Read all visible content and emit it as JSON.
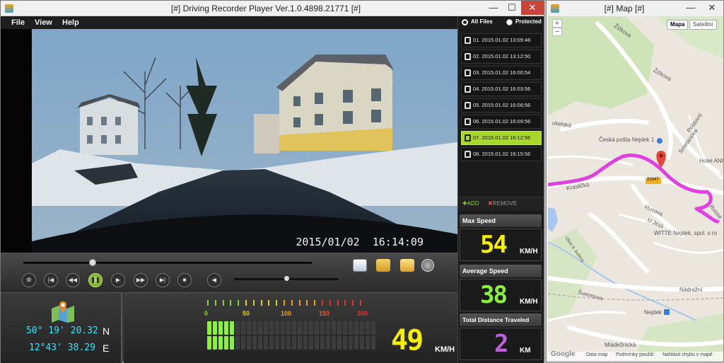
{
  "player": {
    "title": "[#] Driving Recorder Player Ver.1.0.4898.21771 [#]",
    "menu": [
      "File",
      "View",
      "Help"
    ],
    "video": {
      "timestamp": "2015/01/02  16:14:09"
    },
    "seek": {
      "position": 0.24
    },
    "volume": {
      "level": 0.5
    },
    "controls": [
      "settings",
      "prev-file",
      "rewind",
      "pause",
      "play",
      "fast-forward",
      "next-file",
      "stop",
      "volume"
    ],
    "gps": {
      "lat": "50° 19' 20.32",
      "lat_dir": "N",
      "lon": "12°43' 38.29",
      "lon_dir": "E"
    },
    "speedometer": {
      "scale": [
        {
          "label": "0",
          "color": "#8ad23a"
        },
        {
          "label": "50",
          "color": "#e0d020"
        },
        {
          "label": "100",
          "color": "#f0a020"
        },
        {
          "label": "150",
          "color": "#e06030"
        },
        {
          "label": "200",
          "color": "#e03030"
        }
      ],
      "lit_segments": 5,
      "total_segments": 30,
      "current_speed": "49",
      "unit": "KM/H"
    },
    "files": {
      "filter_all": "All Files",
      "filter_protected": "Protected",
      "items": [
        "01. 2015.01.02 13:09:48",
        "02. 2015.01.02 13:12:50",
        "03. 2015.01.02 16:00:54",
        "04. 2015.01.02 16:03:56",
        "05. 2015.01.02 16:06:56",
        "06. 2015.01.02 16:09:56",
        "07. 2015.01.02 16:12:56",
        "08. 2015.01.02 16:15:56"
      ],
      "selected_index": 6,
      "add_label": "ADD",
      "remove_label": "REMOVE"
    },
    "stats": {
      "max_speed_title": "Max Speed",
      "max_speed_value": "54",
      "max_speed_unit": "KM/H",
      "avg_speed_title": "Average Speed",
      "avg_speed_value": "38",
      "avg_speed_unit": "KM/H",
      "distance_title": "Total Distance Traveled",
      "distance_value": "2",
      "distance_unit": "KM"
    },
    "colors": {
      "accent_green": "#a8d82a",
      "speed_yellow": "#f4f000",
      "avg_green": "#8af03a",
      "distance_purple": "#c060e0",
      "coord_cyan": "#32e6ff"
    }
  },
  "map": {
    "title": "[#] Map [#]",
    "type_buttons": [
      "Mapa",
      "Satelitní"
    ],
    "zoom_in": "+",
    "zoom_out": "−",
    "labels": {
      "zizkova_1": "Žižkova",
      "zizkova_2": "Žižkova",
      "pustovni": "Poštovní",
      "sukelska": "ukelská",
      "posta": "Česká pošta Nejdek 1",
      "smetanova": "Smetanova",
      "hotel": "Hotel ANI",
      "krasilcka": "Krasličká",
      "road_no": "21047",
      "husova": "Husova",
      "ujesli": "U Jesli",
      "roose": "Roose",
      "witte": "WITTE Nejdek, spol. s ro",
      "devetkveta": "Ulice 9. května",
      "nadrazni": "Nádražní",
      "svermova": "Švermova",
      "nejdek": "Nejdek",
      "mladeznicka": "Mládežnická"
    },
    "footer": {
      "logo": "Google",
      "data": "Data map",
      "terms": "Podmínky použití",
      "report": "Nahlásit chybu v mapě"
    },
    "route_color": "#e040e0"
  }
}
